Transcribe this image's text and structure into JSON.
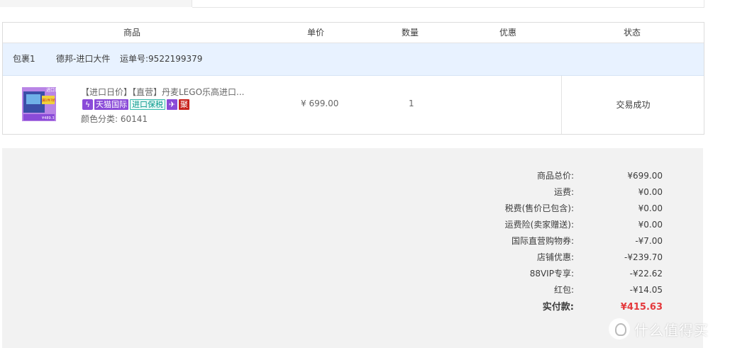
{
  "table": {
    "headers": [
      "商品",
      "单价",
      "数量",
      "优惠",
      "状态"
    ]
  },
  "package": {
    "label": "包裹1",
    "carrier": "德邦-进口大件",
    "tracking": "运单号:9522199379"
  },
  "item": {
    "thumb_text_top": "进口日",
    "thumb_text_mid": "满1件7折",
    "thumb_price": "¥489.3",
    "title": "【进口日价】【直营】丹麦LEGO乐高进口...",
    "badges": {
      "bolt": "ϟ",
      "tmall_intl": "天猫国际",
      "bonded": "进口保税",
      "plane": "✈",
      "ju": "聚"
    },
    "color_label": "颜色分类:  60141",
    "price": "¥ 699.00",
    "quantity": "1",
    "status": "交易成功"
  },
  "summary": {
    "rows": [
      {
        "label": "商品总价:",
        "value": "¥699.00"
      },
      {
        "label": "运费:",
        "value": "¥0.00"
      },
      {
        "label": "税费(售价已包含):",
        "value": "¥0.00"
      },
      {
        "label": "运费险(卖家赠送):",
        "value": "¥0.00"
      },
      {
        "label": "国际直营购物券:",
        "value": "-¥7.00"
      },
      {
        "label": "店铺优惠:",
        "value": "-¥239.70"
      },
      {
        "label": "88VIP专享:",
        "value": "-¥22.62"
      },
      {
        "label": "红包:",
        "value": "-¥14.05"
      }
    ],
    "total_label": "实付款:",
    "total_value": "¥415.63"
  },
  "watermark": {
    "text": "什么值得买"
  },
  "colors": {
    "accent_red": "#e4393c",
    "package_bg": "#e8f2ff",
    "summary_bg": "#f2f2f2",
    "badge_purple": "#8a4bd8"
  }
}
